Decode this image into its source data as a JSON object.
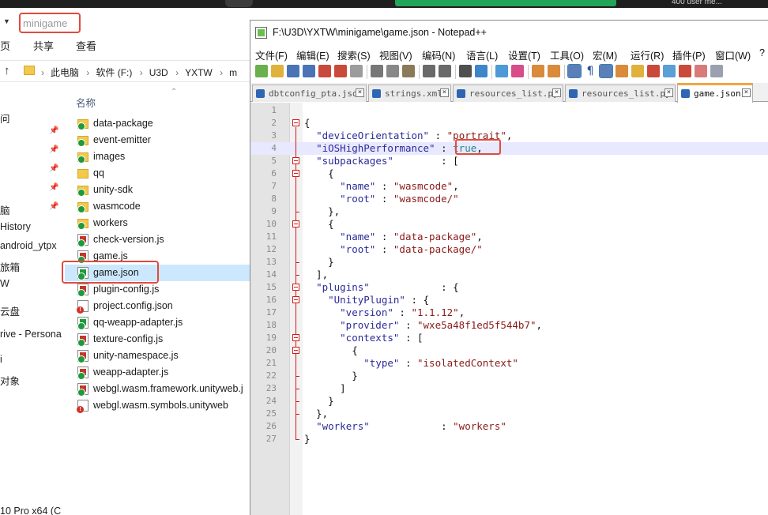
{
  "top_strip": {
    "user_text": "400 user me..."
  },
  "explorer": {
    "window_title": "minigame",
    "ribbon": [
      "页",
      "共享",
      "查看"
    ],
    "breadcrumb": [
      "此电脑",
      "软件 (F:)",
      "U3D",
      "YXTW",
      "m"
    ],
    "nav_items": [
      "问",
      "脑",
      "History",
      "android_ytpx",
      "旅箱",
      "W",
      "云盘",
      "rive - Persona",
      "i",
      "对象",
      "10 Pro x64 (C"
    ],
    "column_header": "名称",
    "files": [
      {
        "name": "data-package",
        "type": "folder-sync"
      },
      {
        "name": "event-emitter",
        "type": "folder-sync"
      },
      {
        "name": "images",
        "type": "folder-sync"
      },
      {
        "name": "qq",
        "type": "folder"
      },
      {
        "name": "unity-sdk",
        "type": "folder-sync"
      },
      {
        "name": "wasmcode",
        "type": "folder-sync"
      },
      {
        "name": "workers",
        "type": "folder-sync"
      },
      {
        "name": "check-version.js",
        "type": "js"
      },
      {
        "name": "game.js",
        "type": "js"
      },
      {
        "name": "game.json",
        "type": "json"
      },
      {
        "name": "plugin-config.js",
        "type": "js"
      },
      {
        "name": "project.config.json",
        "type": "json-warn"
      },
      {
        "name": "qq-weapp-adapter.js",
        "type": "json"
      },
      {
        "name": "texture-config.js",
        "type": "js"
      },
      {
        "name": "unity-namespace.js",
        "type": "js"
      },
      {
        "name": "weapp-adapter.js",
        "type": "js"
      },
      {
        "name": "webgl.wasm.framework.unityweb.j",
        "type": "js"
      },
      {
        "name": "webgl.wasm.symbols.unityweb",
        "type": "warn"
      }
    ]
  },
  "npp": {
    "title": "F:\\U3D\\YXTW\\minigame\\game.json - Notepad++",
    "menu": [
      "文件(F)",
      "编辑(E)",
      "搜索(S)",
      "视图(V)",
      "编码(N)",
      "语言(L)",
      "设置(T)",
      "工具(O)",
      "宏(M)",
      "运行(R)",
      "插件(P)",
      "窗口(W)",
      "?"
    ],
    "tabs": [
      "dbtconfig_pta.json",
      "strings.xml",
      "resources_list.py",
      "resources_list.py",
      "game.json"
    ],
    "active_tab": "game.json",
    "lines": [
      "",
      "{",
      "  \"deviceOrientation\" : \"portrait\",",
      "  \"iOSHighPerformance\" : true,",
      "  \"subpackages\"        : [",
      "    {",
      "      \"name\" : \"wasmcode\",",
      "      \"root\" : \"wasmcode/\"",
      "    },",
      "    {",
      "      \"name\" : \"data-package\",",
      "      \"root\" : \"data-package/\"",
      "    }",
      "  ],",
      "  \"plugins\"            : {",
      "    \"UnityPlugin\" : {",
      "      \"version\" : \"1.1.12\",",
      "      \"provider\" : \"wxe5a48f1ed5f544b7\",",
      "      \"contexts\" : [",
      "        {",
      "          \"type\" : \"isolatedContext\"",
      "        }",
      "      ]",
      "    }",
      "  },",
      "  \"workers\"            : \"workers\"",
      "}"
    ],
    "line_numbers": [
      "1",
      "2",
      "3",
      "4",
      "5",
      "6",
      "7",
      "8",
      "9",
      "10",
      "11",
      "12",
      "13",
      "14",
      "15",
      "16",
      "17",
      "18",
      "19",
      "20",
      "21",
      "22",
      "23",
      "24",
      "25",
      "26",
      "27"
    ],
    "current_line": 4
  },
  "colors": {
    "highlight_box": "#e04b3f",
    "json_key": "#2b2b9a",
    "json_string": "#8a1a1a",
    "json_keyword": "#1b8c8a"
  }
}
